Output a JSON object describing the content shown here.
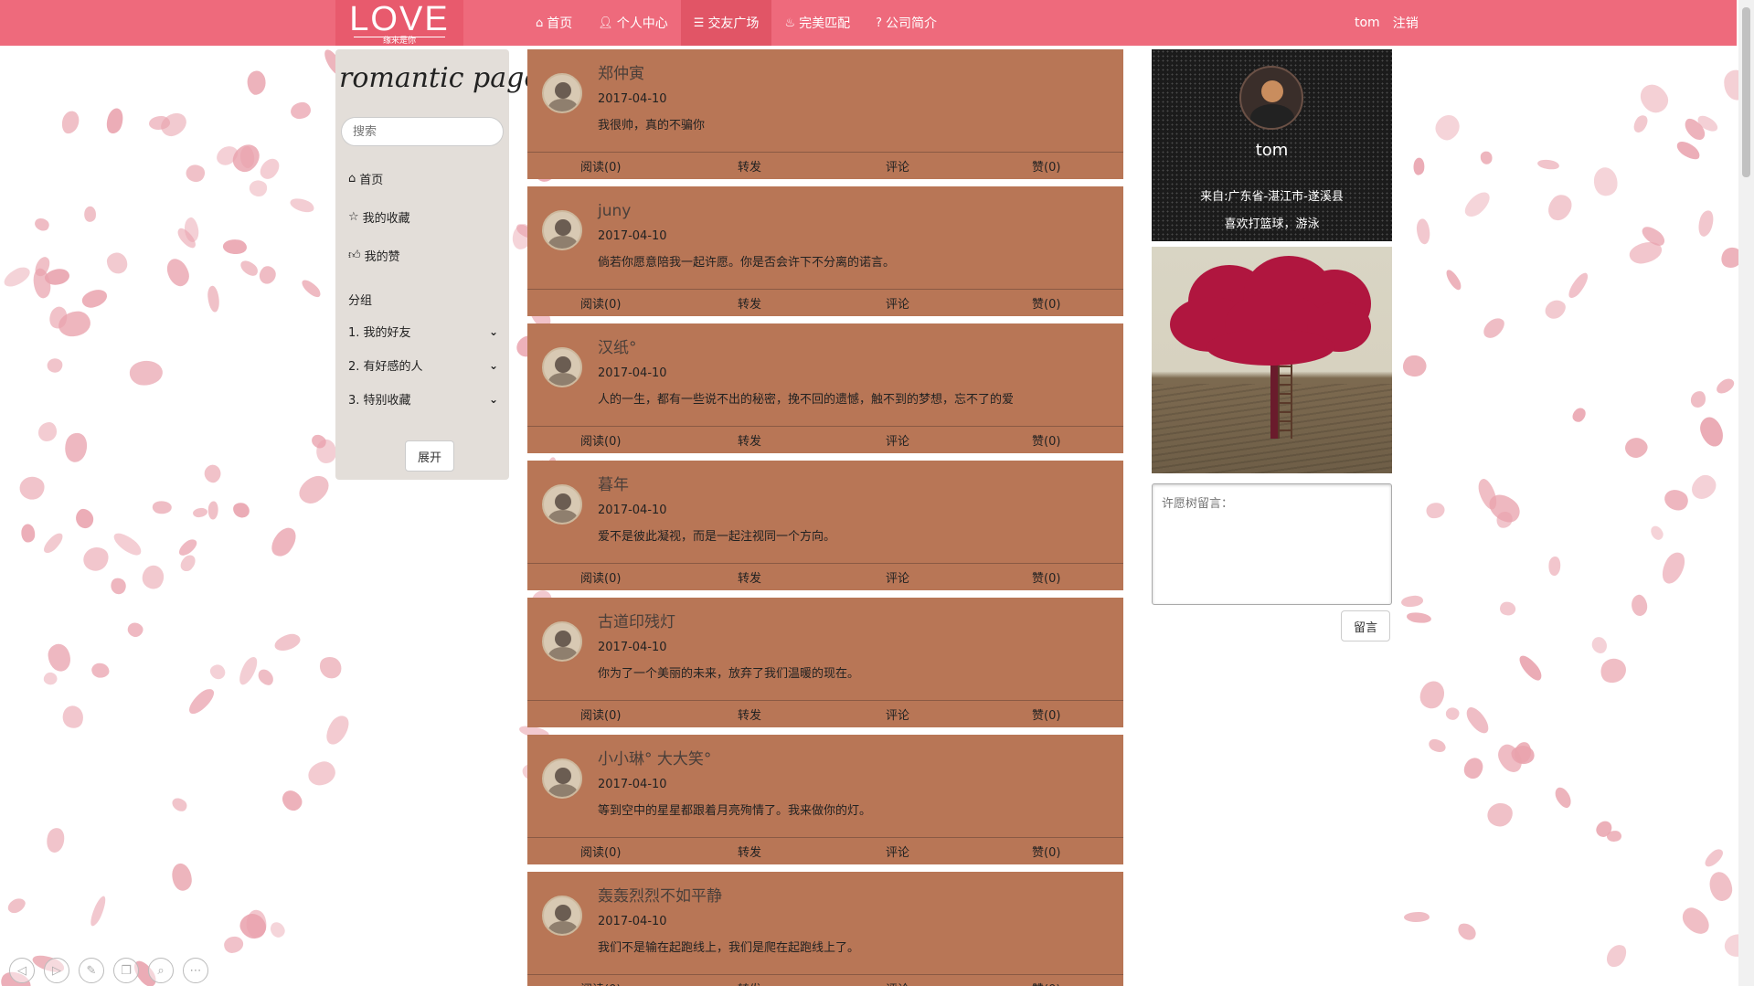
{
  "logo": {
    "main": "LOVE",
    "sub": "缘来是你"
  },
  "nav": {
    "items": [
      {
        "label": "首页",
        "icon": "home-icon"
      },
      {
        "label": "个人中心",
        "icon": "user-icon"
      },
      {
        "label": "交友广场",
        "icon": "list-icon",
        "active": true
      },
      {
        "label": "完美匹配",
        "icon": "fire-icon"
      },
      {
        "label": "公司简介",
        "icon": "question-icon"
      }
    ],
    "user": "tom",
    "logout": "注销"
  },
  "sidebar": {
    "brand": "romantic page",
    "search_placeholder": "搜索",
    "menu": [
      {
        "label": "首页",
        "icon": "home-icon"
      },
      {
        "label": "我的收藏",
        "icon": "star-icon"
      },
      {
        "label": "我的赞",
        "icon": "thumbs-up-icon"
      }
    ],
    "group_header": "分组",
    "groups": [
      {
        "label": "1. 我的好友"
      },
      {
        "label": "2. 有好感的人"
      },
      {
        "label": "3. 特别收藏"
      }
    ],
    "expand_label": "展开"
  },
  "actions": {
    "read": "阅读(0)",
    "forward": "转发",
    "comment": "评论",
    "like": "赞(0)"
  },
  "posts": [
    {
      "name": "郑仲寅",
      "date": "2017-04-10",
      "text": "我很帅，真的不骗你"
    },
    {
      "name": "juny",
      "date": "2017-04-10",
      "text": "倘若你愿意陪我一起许愿。你是否会许下不分离的诺言。"
    },
    {
      "name": "汉纸°",
      "date": "2017-04-10",
      "text": "人的一生，都有一些说不出的秘密，挽不回的遗憾，触不到的梦想，忘不了的爱"
    },
    {
      "name": "暮年",
      "date": "2017-04-10",
      "text": "爱不是彼此凝视，而是一起注视同一个方向。"
    },
    {
      "name": "古道印残灯",
      "date": "2017-04-10",
      "text": "你为了一个美丽的未来，放弃了我们温暖的现在。"
    },
    {
      "name": "小小琳° 大大笑°",
      "date": "2017-04-10",
      "text": "等到空中的星星都跟着月亮殉情了。我来做你的灯。"
    },
    {
      "name": "轰轰烈烈不如平静",
      "date": "2017-04-10",
      "text": "我们不是输在起跑线上，我们是爬在起跑线上了。"
    }
  ],
  "profile": {
    "name": "tom",
    "from": "来自:广东省-湛江市-遂溪县",
    "hobby": "喜欢打篮球，游泳"
  },
  "wish": {
    "placeholder": "许愿树留言：",
    "button": "留言"
  },
  "colors": {
    "nav": "#ee6a7c",
    "post_bg": "#b87656",
    "sidebar_bg": "#e3ded9"
  }
}
